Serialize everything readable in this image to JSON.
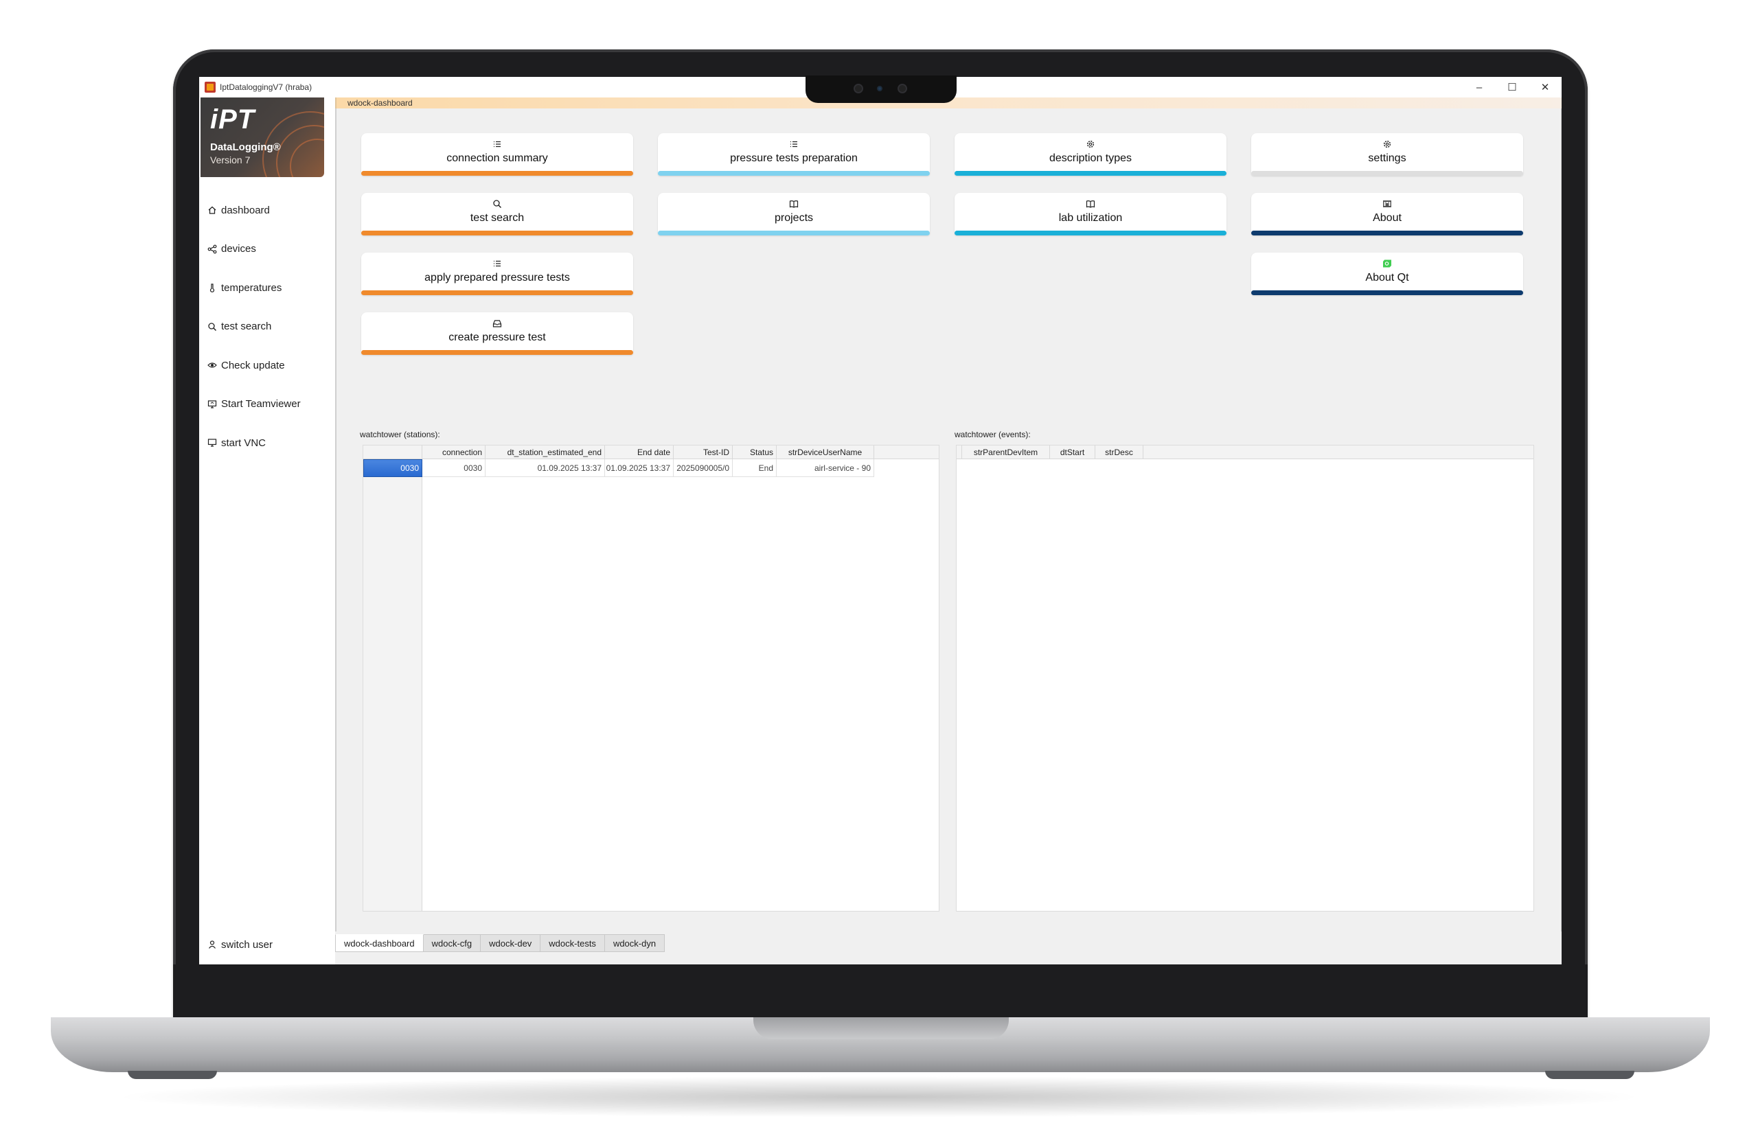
{
  "window": {
    "title": "IptDataloggingV7 (hraba)",
    "controls": {
      "minimize": "–",
      "maximize": "☐",
      "close": "✕"
    }
  },
  "logo": {
    "mark": "iPT",
    "product": "DataLogging®",
    "version": "Version 7"
  },
  "sidebar": {
    "items": [
      {
        "label": "dashboard",
        "icon": "home-icon"
      },
      {
        "label": "devices",
        "icon": "share-icon"
      },
      {
        "label": "temperatures",
        "icon": "thermometer-icon"
      },
      {
        "label": "test search",
        "icon": "search-icon"
      },
      {
        "label": "Check update",
        "icon": "eye-icon"
      },
      {
        "label": "Start Teamviewer",
        "icon": "monitor-share-icon"
      },
      {
        "label": "start VNC",
        "icon": "monitor-icon"
      }
    ],
    "bottom": {
      "label": "switch user",
      "icon": "user-icon"
    }
  },
  "dock": {
    "title": "wdock-dashboard"
  },
  "tiles": [
    {
      "label": "connection summary",
      "icon": "list-icon",
      "accent": "#f08a2c"
    },
    {
      "label": "pressure tests preparation",
      "icon": "list-icon",
      "accent": "#7fd2ef"
    },
    {
      "label": "description types",
      "icon": "gear-icon",
      "accent": "#1ab0d8"
    },
    {
      "label": "settings",
      "icon": "gear-icon",
      "accent": "#dedede"
    },
    {
      "label": "test search",
      "icon": "search-icon",
      "accent": "#f08a2c"
    },
    {
      "label": "projects",
      "icon": "book-icon",
      "accent": "#7fd2ef"
    },
    {
      "label": "lab utilization",
      "icon": "book-icon",
      "accent": "#1ab0d8"
    },
    {
      "label": "About",
      "icon": "ipt-logo-icon",
      "accent": "#0e3b6e"
    },
    {
      "label": "apply prepared pressure tests",
      "icon": "list-icon",
      "accent": "#f08a2c"
    },
    {
      "label": "About Qt",
      "icon": "qt-logo-icon",
      "accent": "#0e3b6e"
    },
    {
      "label": "create pressure test",
      "icon": "inbox-icon",
      "accent": "#f08a2c"
    }
  ],
  "stations": {
    "label": "watchtower (stations):",
    "columns": [
      "connection",
      "dt_station_estimated_end",
      "End date",
      "Test-ID",
      "Status",
      "strDeviceUserName"
    ],
    "rows": [
      {
        "header": "0030",
        "cells": [
          "0030",
          "01.09.2025 13:37",
          "01.09.2025 13:37",
          "2025090005/0",
          "End",
          "airl-service - 90"
        ]
      }
    ]
  },
  "events": {
    "label": "watchtower (events):",
    "columns": [
      "strParentDevItem",
      "dtStart",
      "strDesc"
    ]
  },
  "tabs": [
    "wdock-dashboard",
    "wdock-cfg",
    "wdock-dev",
    "wdock-tests",
    "wdock-dyn"
  ]
}
